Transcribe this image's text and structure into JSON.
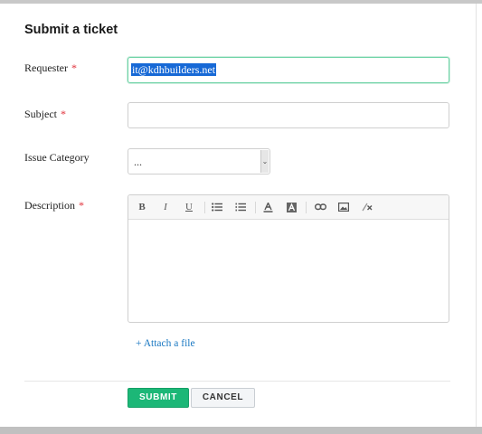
{
  "form": {
    "title": "Submit a ticket",
    "required_mark": "*",
    "requester": {
      "label": "Requester",
      "value": "it@kdhbuilders.net"
    },
    "subject": {
      "label": "Subject",
      "value": ""
    },
    "category": {
      "label": "Issue Category",
      "selected": "...",
      "arrow": "⌄"
    },
    "description": {
      "label": "Description"
    },
    "toolbar": {
      "bold": "B",
      "italic": "I",
      "underline": "U",
      "bullet_list_icon": "bullet-list-icon",
      "numbered_list_icon": "numbered-list-icon",
      "text_color_icon": "text-color-icon",
      "background_color_icon": "background-color-icon",
      "link_icon": "link-icon",
      "image_icon": "image-icon",
      "clear_format_icon": "clear-format-icon"
    },
    "attach_label": "+ Attach a file",
    "submit_label": "SUBMIT",
    "cancel_label": "CANCEL"
  },
  "colors": {
    "accent": "#1cb777",
    "focus_border": "#6ed3a6",
    "required": "#e0303a",
    "link": "#1a78c2",
    "selection": "#1769d6"
  }
}
